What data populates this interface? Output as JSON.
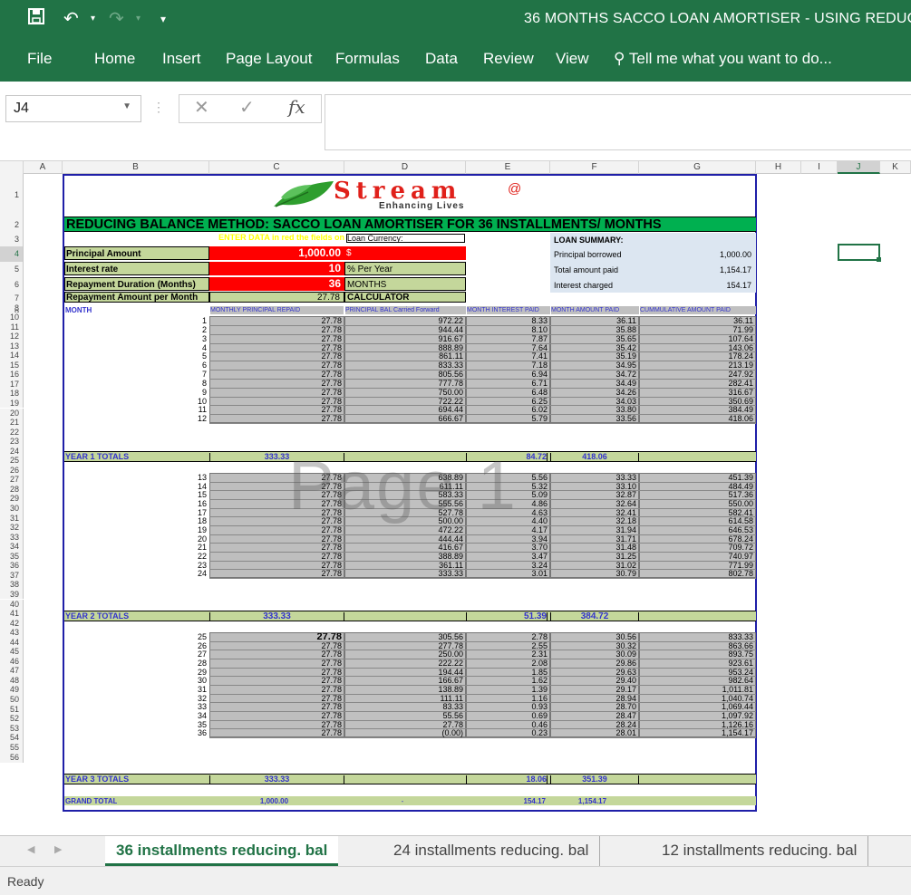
{
  "window": {
    "title": "36 MONTHS SACCO LOAN AMORTISER - USING REDUC"
  },
  "menu": [
    "File",
    "Home",
    "Insert",
    "Page Layout",
    "Formulas",
    "Data",
    "Review",
    "View"
  ],
  "tellme": "Tell me what you want to do...",
  "namebox": "J4",
  "fx_label": "fx",
  "columns": [
    "A",
    "B",
    "C",
    "D",
    "E",
    "F",
    "G",
    "H",
    "I",
    "J",
    "K"
  ],
  "rows": [
    "1",
    "2",
    "3",
    "4",
    "5",
    "6",
    "7",
    "8",
    "9",
    "10",
    "11",
    "12",
    "13",
    "14",
    "15",
    "16",
    "17",
    "18",
    "19",
    "20",
    "21",
    "22",
    "23",
    "24",
    "25",
    "26",
    "27",
    "28",
    "29",
    "30",
    "31",
    "32",
    "33",
    "34",
    "35",
    "36",
    "37",
    "38",
    "39",
    "40",
    "41",
    "42",
    "43",
    "44",
    "45",
    "46",
    "47",
    "48",
    "49",
    "50",
    "51",
    "52",
    "53",
    "54",
    "55",
    "56"
  ],
  "logo": {
    "name": "Stream",
    "tagline": "Enhancing Lives"
  },
  "sheet": {
    "banner": "REDUCING BALANCE METHOD: SACCO  LOAN  AMORTISER FOR 36 INSTALLMENTS/ MONTHS",
    "enter_note": "ENTER DATA in red the fields on",
    "loan_currency_label": "Loan Currency:",
    "principal_label": "Principal Amount",
    "principal_value": "1,000.00",
    "currency_symbol": "$",
    "rate_label": "Interest rate",
    "rate_value": "10",
    "rate_unit": "% Per Year",
    "duration_label": "Repayment Duration (Months)",
    "duration_value": "36",
    "duration_unit": "MONTHS",
    "repay_label": "Repayment Amount per Month",
    "repay_value": "27.78",
    "calculator": "CALCULATOR",
    "summary_title": "LOAN SUMMARY:",
    "summary": [
      {
        "label": "Principal borrowed",
        "value": "1,000.00"
      },
      {
        "label": "Total amount paid",
        "value": "1,154.17"
      },
      {
        "label": "Interest charged",
        "value": "154.17"
      }
    ],
    "headers": [
      "MONTH",
      "MONTHLY PRINCIPAL REPAID",
      "PRINCIPAL BAL Carried Forward",
      "MONTH INTEREST PAID",
      "MONTH AMOUNT PAID",
      "CUMMULATIVE AMOUNT PAID"
    ],
    "watermark": "Page 1",
    "years": [
      {
        "label": "YEAR 1 TOTALS",
        "principal": "333.33",
        "interest": "84.72",
        "amount": "418.06",
        "rows": [
          [
            "1",
            "27.78",
            "972.22",
            "8.33",
            "36.11",
            "36.11"
          ],
          [
            "2",
            "27.78",
            "944.44",
            "8.10",
            "35.88",
            "71.99"
          ],
          [
            "3",
            "27.78",
            "916.67",
            "7.87",
            "35.65",
            "107.64"
          ],
          [
            "4",
            "27.78",
            "888.89",
            "7.64",
            "35.42",
            "143.06"
          ],
          [
            "5",
            "27.78",
            "861.11",
            "7.41",
            "35.19",
            "178.24"
          ],
          [
            "6",
            "27.78",
            "833.33",
            "7.18",
            "34.95",
            "213.19"
          ],
          [
            "7",
            "27.78",
            "805.56",
            "6.94",
            "34.72",
            "247.92"
          ],
          [
            "8",
            "27.78",
            "777.78",
            "6.71",
            "34.49",
            "282.41"
          ],
          [
            "9",
            "27.78",
            "750.00",
            "6.48",
            "34.26",
            "316.67"
          ],
          [
            "10",
            "27.78",
            "722.22",
            "6.25",
            "34.03",
            "350.69"
          ],
          [
            "11",
            "27.78",
            "694.44",
            "6.02",
            "33.80",
            "384.49"
          ],
          [
            "12",
            "27.78",
            "666.67",
            "5.79",
            "33.56",
            "418.06"
          ]
        ]
      },
      {
        "label": "YEAR 2 TOTALS",
        "principal": "333.33",
        "interest": "51.39",
        "amount": "384.72",
        "rows": [
          [
            "13",
            "27.78",
            "638.89",
            "5.56",
            "33.33",
            "451.39"
          ],
          [
            "14",
            "27.78",
            "611.11",
            "5.32",
            "33.10",
            "484.49"
          ],
          [
            "15",
            "27.78",
            "583.33",
            "5.09",
            "32.87",
            "517.36"
          ],
          [
            "16",
            "27.78",
            "555.56",
            "4.86",
            "32.64",
            "550.00"
          ],
          [
            "17",
            "27.78",
            "527.78",
            "4.63",
            "32.41",
            "582.41"
          ],
          [
            "18",
            "27.78",
            "500.00",
            "4.40",
            "32.18",
            "614.58"
          ],
          [
            "19",
            "27.78",
            "472.22",
            "4.17",
            "31.94",
            "646.53"
          ],
          [
            "20",
            "27.78",
            "444.44",
            "3.94",
            "31.71",
            "678.24"
          ],
          [
            "21",
            "27.78",
            "416.67",
            "3.70",
            "31.48",
            "709.72"
          ],
          [
            "22",
            "27.78",
            "388.89",
            "3.47",
            "31.25",
            "740.97"
          ],
          [
            "23",
            "27.78",
            "361.11",
            "3.24",
            "31.02",
            "771.99"
          ],
          [
            "24",
            "27.78",
            "333.33",
            "3.01",
            "30.79",
            "802.78"
          ]
        ]
      },
      {
        "label": "YEAR 3 TOTALS",
        "principal": "333.33",
        "interest": "18.06",
        "amount": "351.39",
        "rows": [
          [
            "25",
            "27.78",
            "305.56",
            "2.78",
            "30.56",
            "833.33"
          ],
          [
            "26",
            "27.78",
            "277.78",
            "2.55",
            "30.32",
            "863.66"
          ],
          [
            "27",
            "27.78",
            "250.00",
            "2.31",
            "30.09",
            "893.75"
          ],
          [
            "28",
            "27.78",
            "222.22",
            "2.08",
            "29.86",
            "923.61"
          ],
          [
            "29",
            "27.78",
            "194.44",
            "1.85",
            "29.63",
            "953.24"
          ],
          [
            "30",
            "27.78",
            "166.67",
            "1.62",
            "29.40",
            "982.64"
          ],
          [
            "31",
            "27.78",
            "138.89",
            "1.39",
            "29.17",
            "1,011.81"
          ],
          [
            "32",
            "27.78",
            "111.11",
            "1.16",
            "28.94",
            "1,040.74"
          ],
          [
            "33",
            "27.78",
            "83.33",
            "0.93",
            "28.70",
            "1,069.44"
          ],
          [
            "34",
            "27.78",
            "55.56",
            "0.69",
            "28.47",
            "1,097.92"
          ],
          [
            "35",
            "27.78",
            "27.78",
            "0.46",
            "28.24",
            "1,126.16"
          ],
          [
            "36",
            "27.78",
            "(0.00)",
            "0.23",
            "28.01",
            "1,154.17"
          ]
        ]
      }
    ],
    "grand": {
      "label": "GRAND TOTAL",
      "principal": "1,000.00",
      "balance": "-",
      "interest": "154.17",
      "amount": "1,154.17"
    }
  },
  "tabs": [
    "36 installments reducing. bal",
    "24 installments reducing. bal",
    "12 installments reducing. bal"
  ],
  "status": "Ready",
  "colors": {
    "excel_green": "#217346",
    "input_red": "#ff0000",
    "label_green": "#c4d79b",
    "data_gray": "#c0c0c0",
    "header_blue": "#3333cc",
    "banner_green": "#00b050"
  }
}
